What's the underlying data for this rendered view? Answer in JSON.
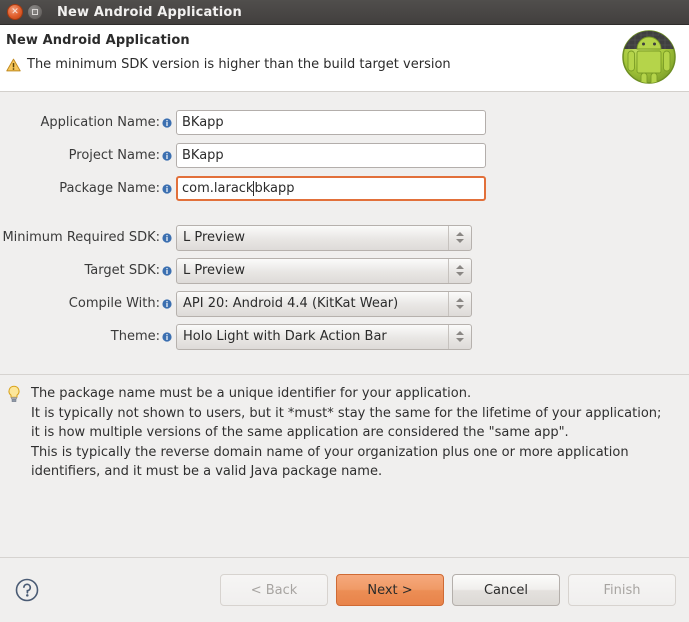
{
  "window": {
    "title": "New Android Application",
    "close_icon": "close-icon",
    "maximize_icon": "maximize-icon"
  },
  "header": {
    "title": "New Android Application",
    "message": "The minimum SDK version is higher than the build target version",
    "warning_icon": "warning-triangle-icon",
    "brand_icon": "android-robot-icon"
  },
  "form": {
    "fields": [
      {
        "label": "Application Name:",
        "value": "BKapp",
        "type": "text",
        "focused": false,
        "name": "application-name"
      },
      {
        "label": "Project Name:",
        "value": "BKapp",
        "type": "text",
        "focused": false,
        "name": "project-name"
      },
      {
        "label": "Package Name:",
        "value": "com.larackbkapp",
        "value_before_caret": "com.larack",
        "value_after_caret": "bkapp",
        "type": "text",
        "focused": true,
        "name": "package-name"
      }
    ],
    "dropdowns": [
      {
        "label": "Minimum Required SDK:",
        "value": "L Preview",
        "name": "minimum-required-sdk"
      },
      {
        "label": "Target SDK:",
        "value": "L Preview",
        "name": "target-sdk"
      },
      {
        "label": "Compile With:",
        "value": "API 20: Android 4.4 (KitKat Wear)",
        "name": "compile-with"
      },
      {
        "label": "Theme:",
        "value": "Holo Light with Dark Action Bar",
        "name": "theme"
      }
    ],
    "info_icon": "info-icon"
  },
  "help": {
    "icon": "lightbulb-icon",
    "line1": "The package name must be a unique identifier for your application.",
    "line2": "It is typically not shown to users, but it *must* stay the same for the lifetime of your application;",
    "line3": "it is how multiple versions of the same application are considered the \"same app\".",
    "line4": "This is typically the reverse domain name of your organization plus one or more application",
    "line5": "identifiers, and it must be a valid Java package name."
  },
  "buttons": {
    "help_icon": "question-mark-help-icon",
    "back": "< Back",
    "next": "Next >",
    "cancel": "Cancel",
    "finish": "Finish"
  },
  "colors": {
    "accent_orange": "#e8834a",
    "focus_border": "#e2703a",
    "titlebar": "#423f3e",
    "panel_bg": "#f0efee",
    "android_green": "#a4c639"
  }
}
